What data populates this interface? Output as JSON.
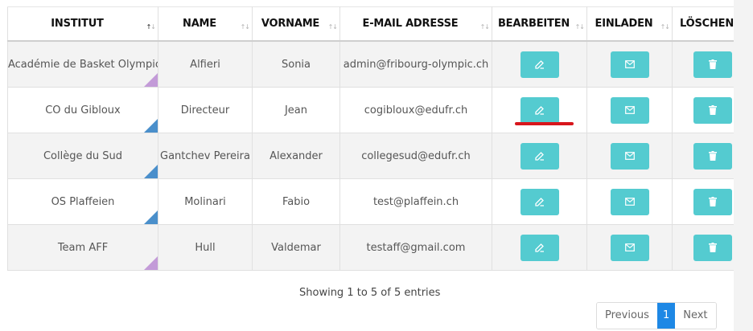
{
  "columns": [
    {
      "label": "INSTITUT",
      "sort": "asc"
    },
    {
      "label": "NAME",
      "sort": "none"
    },
    {
      "label": "VORNAME",
      "sort": "none"
    },
    {
      "label": "E-MAIL ADRESSE",
      "sort": "none"
    },
    {
      "label": "BEARBEITEN",
      "sort": "none"
    },
    {
      "label": "EINLADEN",
      "sort": "none"
    },
    {
      "label": "LÖSCHEN",
      "sort": "none"
    }
  ],
  "sort_glyph": {
    "up": "↑",
    "down": "↓"
  },
  "rows": [
    {
      "institut": "Académie de Basket Olympic",
      "name": "Alfieri",
      "vorname": "Sonia",
      "email": "admin@fribourg-olympic.ch",
      "corner_color": "#c39bd8"
    },
    {
      "institut": "CO du Gibloux",
      "name": "Directeur",
      "vorname": "Jean",
      "email": "cogibloux@edufr.ch",
      "corner_color": "#4a8fcb"
    },
    {
      "institut": "Collège du Sud",
      "name": "Gantchev Pereira",
      "vorname": "Alexander",
      "email": "collegesud@edufr.ch",
      "corner_color": "#4a8fcb"
    },
    {
      "institut": "OS Plaffeien",
      "name": "Molinari",
      "vorname": "Fabio",
      "email": "test@plaffein.ch",
      "corner_color": "#4a8fcb"
    },
    {
      "institut": "Team AFF",
      "name": "Hull",
      "vorname": "Valdemar",
      "email": "testaff@gmail.com",
      "corner_color": "#c39bd8"
    }
  ],
  "actions": {
    "edit_icon": "edit-icon",
    "invite_icon": "envelope-icon",
    "delete_icon": "trash-icon",
    "button_color": "#54cbd0"
  },
  "info": "Showing 1 to 5 of 5 entries",
  "pagination": {
    "previous": "Previous",
    "pages": [
      "1"
    ],
    "current": "1",
    "next": "Next",
    "active_color": "#1e88e5"
  },
  "highlight_color": "#d8161c"
}
